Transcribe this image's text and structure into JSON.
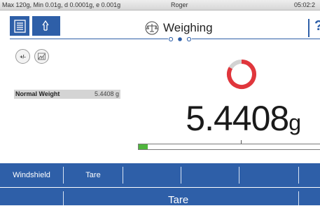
{
  "status_bar": {
    "spec": "Max 120g, Min 0.01g, d 0.0001g, e 0.001g",
    "user": "Roger",
    "time": "05:02:2"
  },
  "header": {
    "title": "Weighing",
    "help": "?",
    "menu_icon": "list-menu-icon",
    "transfer_icon": "up-down-arrows-icon",
    "title_icon": "balance-scale-icon",
    "page_indicator": {
      "count": 3,
      "active": 2
    }
  },
  "tools": [
    {
      "name": "plus-minus-icon",
      "label": "+/-"
    },
    {
      "name": "statistics-icon"
    }
  ],
  "info_field": {
    "label": "Normal Weight",
    "value": "5.4408 g"
  },
  "reading": {
    "value": "5.4408",
    "unit": "g",
    "status_color": "#e0363c"
  },
  "weighing_bar": {
    "fill_fraction": 0.05,
    "fill_color": "#4fb53c"
  },
  "softkeys": {
    "row1": [
      "Windshield",
      "Tare",
      "",
      "",
      "",
      ""
    ],
    "row2_label": "Tare"
  },
  "colors": {
    "accent": "#2e5fa8",
    "status_ring": "#e0363c"
  }
}
